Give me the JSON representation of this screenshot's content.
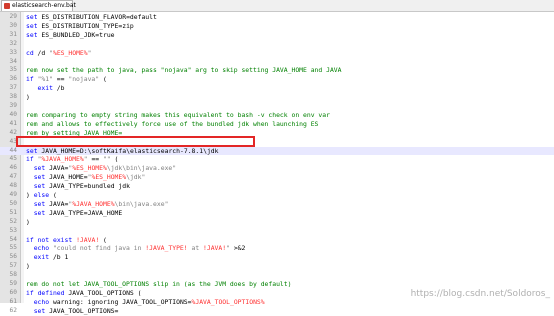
{
  "tab": {
    "label": "elasticsearch-env.bat",
    "icon": "file-modified-icon",
    "icon_color": "#d23b2e"
  },
  "lines": [
    {
      "n": "29",
      "text": "set ES_DISTRIBUTION_FLAVOR=default"
    },
    {
      "n": "30",
      "text": "set ES_DISTRIBUTION_TYPE=zip"
    },
    {
      "n": "31",
      "text": "set ES_BUNDLED_JDK=true"
    },
    {
      "n": "32",
      "text": ""
    },
    {
      "n": "33",
      "text": "cd /d \"%ES_HOME%\""
    },
    {
      "n": "34",
      "text": ""
    },
    {
      "n": "35",
      "text": "rem now set the path to java, pass \"nojava\" arg to skip setting JAVA_HOME and JAVA"
    },
    {
      "n": "36",
      "text": "if \"%1\" == \"nojava\" ("
    },
    {
      "n": "37",
      "text": "   exit /b"
    },
    {
      "n": "38",
      "text": ")"
    },
    {
      "n": "39",
      "text": ""
    },
    {
      "n": "40",
      "text": "rem comparing to empty string makes this equivalent to bash -v check on env var"
    },
    {
      "n": "41",
      "text": "rem and allows to effectively force use of the bundled jdk when launching ES"
    },
    {
      "n": "42",
      "text": "rem by setting JAVA_HOME="
    },
    {
      "n": "43",
      "text": ""
    },
    {
      "n": "44",
      "text": "set JAVA_HOME=D:\\softKaifa\\elasticsearch-7.8.1\\jdk"
    },
    {
      "n": "45",
      "text": "if \"%JAVA_HOME%\" == \"\" ("
    },
    {
      "n": "46",
      "text": "  set JAVA=\"%ES_HOME%\\jdk\\bin\\java.exe\""
    },
    {
      "n": "47",
      "text": "  set JAVA_HOME=\"%ES_HOME%\\jdk\""
    },
    {
      "n": "48",
      "text": "  set JAVA_TYPE=bundled jdk"
    },
    {
      "n": "49",
      "text": ") else ("
    },
    {
      "n": "50",
      "text": "  set JAVA=\"%JAVA_HOME%\\bin\\java.exe\""
    },
    {
      "n": "51",
      "text": "  set JAVA_TYPE=JAVA_HOME"
    },
    {
      "n": "52",
      "text": ")"
    },
    {
      "n": "53",
      "text": ""
    },
    {
      "n": "54",
      "text": "if not exist !JAVA! ("
    },
    {
      "n": "55",
      "text": "  echo \"could not find java in !JAVA_TYPE! at !JAVA!\" >&2"
    },
    {
      "n": "56",
      "text": "  exit /b 1"
    },
    {
      "n": "57",
      "text": ")"
    },
    {
      "n": "58",
      "text": ""
    },
    {
      "n": "59",
      "text": "rem do not let JAVA_TOOL_OPTIONS slip in (as the JVM does by default)"
    },
    {
      "n": "60",
      "text": "if defined JAVA_TOOL_OPTIONS ("
    },
    {
      "n": "61",
      "text": "  echo warning: ignoring JAVA_TOOL_OPTIONS=%JAVA_TOOL_OPTIONS%"
    },
    {
      "n": "62",
      "text": "  set JAVA_TOOL_OPTIONS="
    }
  ],
  "highlighted_line": "44",
  "highlight_color": "#e32626",
  "watermark": "https://blog.csdn.net/Soldoros_"
}
